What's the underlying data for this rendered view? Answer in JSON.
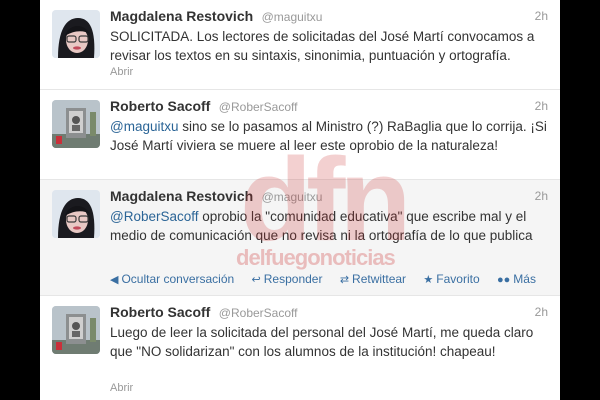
{
  "tweets": [
    {
      "name": "Magdalena Restovich",
      "handle": "@maguitxu",
      "time": "2h",
      "text": "SOLICITADA. Los lectores de solicitadas del José Martí convocamos a revisar los textos en su sintaxis, sinonimia, puntuación y ortografía.",
      "footer": "Abrir"
    },
    {
      "name": "Roberto Sacoff",
      "handle": "@RoberSacoff",
      "time": "2h",
      "mention": "@maguitxu",
      "text_rest": " sino se lo pasamos al Ministro (?) RaBaglia que lo corrija. ¡Si José Martí viviera se muere al leer este oprobio de la naturaleza!"
    },
    {
      "name": "Magdalena Restovich",
      "handle": "@maguitxu",
      "time": "2h",
      "mention": "@RoberSacoff",
      "text_rest": " oprobio la \"comunidad educativa\" que escribe mal y el medio de comunicación que no revisa ni la ortografía de lo que publica",
      "actions": [
        {
          "icon": "arrow-left-icon",
          "label": "Ocultar conversación"
        },
        {
          "icon": "reply-icon",
          "label": "Responder"
        },
        {
          "icon": "retweet-icon",
          "label": "Retwittear"
        },
        {
          "icon": "star-icon",
          "label": "Favorito"
        },
        {
          "icon": "more-icon",
          "label": "Más"
        }
      ]
    },
    {
      "name": "Roberto Sacoff",
      "handle": "@RoberSacoff",
      "time": "2h",
      "text": "Luego de leer la solicitada del personal del José Martí, me queda claro  que \"NO solidarizan\" con los alumnos de la institución! chapeau!",
      "footer": "Abrir"
    }
  ],
  "watermark": {
    "main": "dfn",
    "sub": "delfuegonoticias"
  },
  "colors": {
    "link": "#2a6496",
    "muted": "#999999",
    "highlight_bg": "#f5f5f5",
    "watermark": "#c82828"
  }
}
